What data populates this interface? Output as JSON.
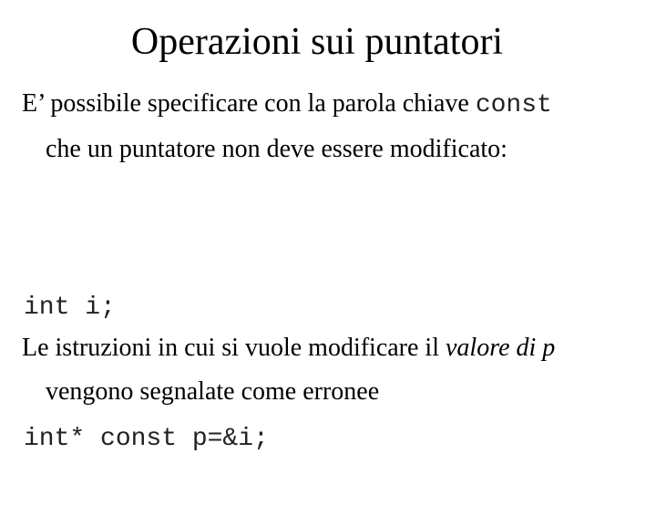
{
  "slide": {
    "title": "Operazioni sui puntatori",
    "paragraph1": {
      "line1_text": "E’ possibile specificare con la parola chiave ",
      "line1_keyword": "const",
      "line2_text": "che un puntatore non deve essere modificato:"
    },
    "code": {
      "lines": [
        "int i;",
        "int* const p=&i;"
      ]
    },
    "paragraph2": {
      "line1_text": "Le istruzioni in cui si vuole modificare il ",
      "line1_italic": "valore di p",
      "line2_text": "vengono segnalate come erronee"
    }
  }
}
